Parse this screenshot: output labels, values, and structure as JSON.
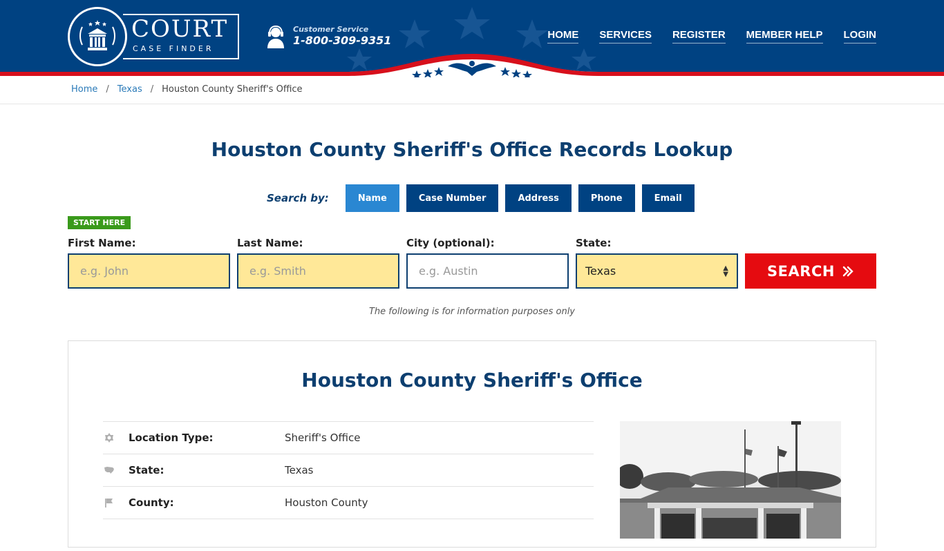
{
  "header": {
    "logo_title": "COURT",
    "logo_subtitle": "CASE FINDER",
    "customer_service_label": "Customer Service",
    "customer_service_phone": "1-800-309-9351",
    "nav": [
      "HOME",
      "SERVICES",
      "REGISTER",
      "MEMBER HELP",
      "LOGIN"
    ],
    "brand_color": "#004282",
    "accent_red": "#d7101c"
  },
  "breadcrumb": {
    "home": "Home",
    "state": "Texas",
    "current": "Houston County Sheriff's Office",
    "separator": "/"
  },
  "page_title": "Houston County Sheriff's Office Records Lookup",
  "search": {
    "by_label": "Search by:",
    "tabs": [
      "Name",
      "Case Number",
      "Address",
      "Phone",
      "Email"
    ],
    "active_tab": "Name",
    "start_here": "START HERE",
    "first_name": {
      "label": "First Name:",
      "placeholder": "e.g. John"
    },
    "last_name": {
      "label": "Last Name:",
      "placeholder": "e.g. Smith"
    },
    "city": {
      "label": "City (optional):",
      "placeholder": "e.g.  Austin"
    },
    "state": {
      "label": "State:",
      "value": "Texas"
    },
    "button": "SEARCH",
    "note": "The following is for information purposes only"
  },
  "card": {
    "title": "Houston County Sheriff's Office",
    "rows": [
      {
        "icon": "badge-icon",
        "key": "Location Type:",
        "value": "Sheriff's Office"
      },
      {
        "icon": "us-map-icon",
        "key": "State:",
        "value": "Texas"
      },
      {
        "icon": "flag-icon",
        "key": "County:",
        "value": "Houston County"
      }
    ]
  }
}
